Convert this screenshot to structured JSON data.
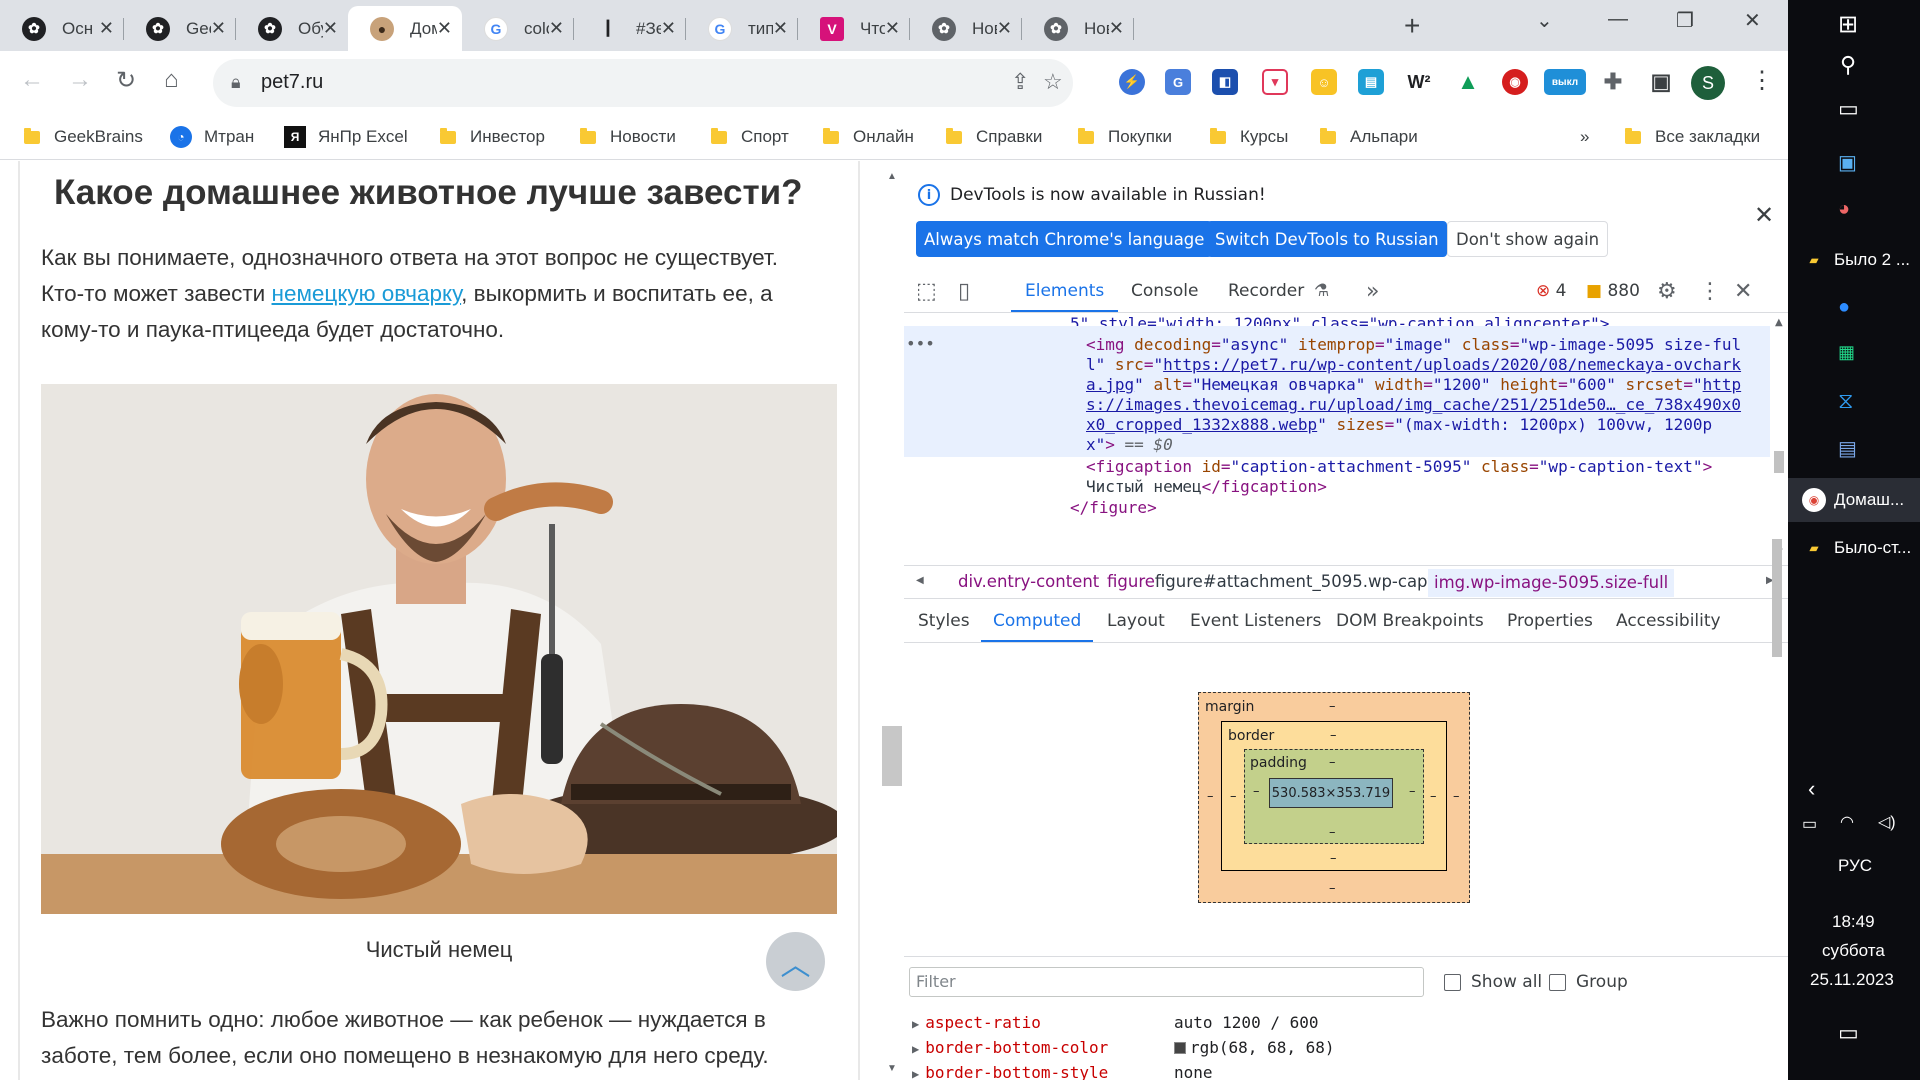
{
  "tabs": [
    {
      "title": "Осн",
      "icon": "openai-icon"
    },
    {
      "title": "Geel",
      "icon": "openai-icon"
    },
    {
      "title": "Обу",
      "icon": "openai-icon"
    },
    {
      "title": "Дом",
      "icon": "pug-icon"
    },
    {
      "title": "colo",
      "icon": "google-icon"
    },
    {
      "title": "#Зе(",
      "icon": "pin-icon"
    },
    {
      "title": "типı",
      "icon": "google-icon"
    },
    {
      "title": "Что",
      "icon": "v-icon"
    },
    {
      "title": "Нов",
      "icon": "openai-icon"
    },
    {
      "title": "Нов",
      "icon": "openai-icon"
    }
  ],
  "address": {
    "url": "pet7.ru"
  },
  "bookmarks": [
    {
      "label": "GeekBrains",
      "type": "folder"
    },
    {
      "label": "Мтран",
      "type": "site"
    },
    {
      "label": "ЯнПр Excel",
      "type": "site"
    },
    {
      "label": "Инвестор",
      "type": "folder"
    },
    {
      "label": "Новости",
      "type": "folder"
    },
    {
      "label": "Спорт",
      "type": "folder"
    },
    {
      "label": "Онлайн",
      "type": "folder"
    },
    {
      "label": "Справки",
      "type": "folder"
    },
    {
      "label": "Покупки",
      "type": "folder"
    },
    {
      "label": "Курсы",
      "type": "folder"
    },
    {
      "label": "Альпари",
      "type": "folder"
    }
  ],
  "bookmarks_overflow": "»",
  "all_bookmarks": "Все закладки",
  "article": {
    "heading": "Какое домашнее животное лучше завести?",
    "p1_a": "Как вы понимаете, однозначного ответа на этот вопрос не существует.",
    "p1_b": "Кто-то может завести ",
    "p1_link": "немецкую овчарку",
    "p1_c": ", выкормить и воспитать ее, а",
    "p1_d": "кому-то и паука-птицееда будет достаточно.",
    "caption": "Чистый немец",
    "p2_a": "Важно помнить одно: любое животное — как ребенок — нуждается в",
    "p2_b": "заботе, тем более, если оно помещено в незнакомую для него среду."
  },
  "devtools": {
    "info_message": "DevTools is now available in Russian!",
    "btn_match": "Always match Chrome's language",
    "btn_switch": "Switch DevTools to Russian",
    "btn_dont_show": "Don't show again",
    "tabs": [
      "Elements",
      "Console",
      "Recorder"
    ],
    "errors": "4",
    "warnings": "880",
    "dom": {
      "l0": "5\" style=\"width: 1200px\" class=\"wp-caption aligncenter\">",
      "img_open": "<img",
      "a_decoding": "decoding",
      "v_decoding": "\"async\"",
      "a_itemprop": "itemprop",
      "v_itemprop": "\"image\"",
      "a_class": "class",
      "v_class_1": "\"wp-image-5095 size-ful",
      "v_class_2": "l\"",
      "a_src": "src",
      "v_src_1": "https://pet7.ru/wp-content/uploads/2020/08/nemeckaya-ovchark",
      "v_src_2": "a.jpg",
      "a_alt": "alt",
      "v_alt": "\"Немецкая овчарка\"",
      "a_width": "width",
      "v_width": "\"1200\"",
      "a_height": "height",
      "v_height": "\"600\"",
      "a_srcset": "srcset",
      "v_srcset_1": "http",
      "v_srcset_2": "s://images.thevoicemag.ru/upload/img_cache/251/251de50…_ce_738x490x0",
      "v_srcset_3": "x0_cropped_1332x888.webp",
      "a_sizes": "sizes",
      "v_sizes_1": "\"(max-width: 1200px) 100vw, 1200p",
      "v_sizes_2": "x\"",
      "dollar": "== $0",
      "figcap_open": "<figcaption",
      "a_id": "id",
      "v_id": "\"caption-attachment-5095\"",
      "v_figcap_class": "\"wp-caption-text\"",
      "figcap_text": "Чистый немец",
      "figcap_close": "</figcaption>",
      "figure_close": "</figure>"
    },
    "breadcrumbs": [
      "div.entry-content",
      "figure#attachment_5095.wp-caption.aligncenter",
      "img.wp-image-5095.size-full"
    ],
    "subtabs": [
      "Styles",
      "Computed",
      "Layout",
      "Event Listeners",
      "DOM Breakpoints",
      "Properties",
      "Accessibility"
    ],
    "boxmodel": {
      "margin": "margin",
      "border": "border",
      "padding": "padding",
      "content": "530.583×353.719",
      "dash": "–"
    },
    "filter_placeholder": "Filter",
    "show_all": "Show all",
    "group": "Group",
    "properties": [
      {
        "name": "aspect-ratio",
        "value": "auto 1200 / 600"
      },
      {
        "name": "border-bottom-color",
        "value": "rgb(68, 68, 68)"
      },
      {
        "name": "border-bottom-style",
        "value": "none"
      }
    ]
  },
  "taskbar": {
    "items": [
      {
        "label": "Было 2 ...",
        "icon": "folder-icon"
      },
      {
        "label": "Домаш...",
        "icon": "chrome-icon"
      },
      {
        "label": "Было-ст...",
        "icon": "folder-icon"
      }
    ],
    "lang": "РУС",
    "time": "18:49",
    "day": "суббота",
    "date": "25.11.2023"
  },
  "colors": {
    "accent": "#1a73e8",
    "link": "#1a9bd7",
    "tag": "#881280",
    "attr": "#994500",
    "attrval": "#1a1aa6"
  }
}
